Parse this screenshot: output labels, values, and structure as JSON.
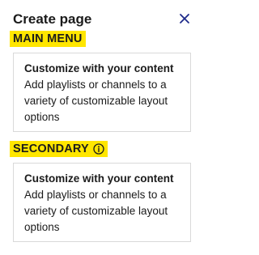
{
  "dialog": {
    "title": "Create page",
    "close_icon": "close-icon"
  },
  "sections": [
    {
      "label": "MAIN MENU",
      "card": {
        "title": "Customize with your content",
        "description": "Add playlists or channels to a variety of customizable layout options"
      }
    },
    {
      "label": "SECONDARY",
      "info_icon": "info-icon",
      "card": {
        "title": "Customize with your content",
        "description": "Add playlists or channels to a variety of customizable layout options"
      }
    }
  ],
  "colors": {
    "highlight": "#ffe600",
    "accent": "#1e2a8a",
    "border": "#d9d9d9",
    "text": "#1b1b1b"
  }
}
